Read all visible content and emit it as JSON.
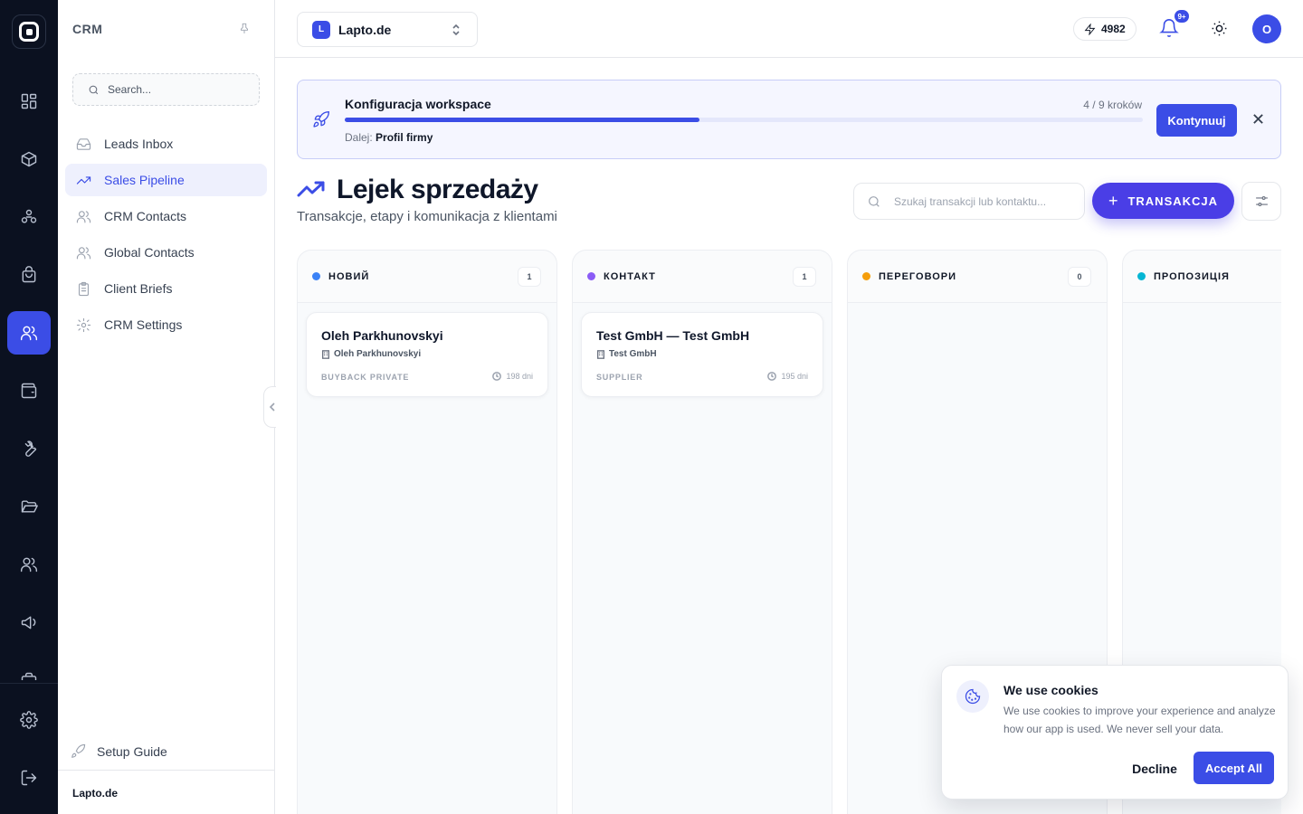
{
  "rail": {
    "items": [
      "logo-mark-icon",
      "dashboard-icon",
      "box-icon",
      "integrations-icon",
      "shopping-bag-icon",
      "users-icon",
      "wallet-icon",
      "wrench-icon",
      "folder-icon",
      "contacts-icon",
      "megaphone-icon",
      "briefcase-icon",
      "gear-icon",
      "logout-icon"
    ],
    "active_item": "users-icon"
  },
  "sidebar": {
    "title": "CRM",
    "search_placeholder": "Search...",
    "items": [
      {
        "label": "Leads Inbox",
        "icon": "inbox-icon"
      },
      {
        "label": "Sales Pipeline",
        "icon": "trending-up-icon",
        "active": true
      },
      {
        "label": "CRM Contacts",
        "icon": "users-icon"
      },
      {
        "label": "Global Contacts",
        "icon": "users-icon"
      },
      {
        "label": "Client Briefs",
        "icon": "clipboard-icon"
      },
      {
        "label": "CRM Settings",
        "icon": "gear-icon"
      }
    ],
    "setup_label": "Setup Guide",
    "footer_workspace": "Lapto.de"
  },
  "topbar": {
    "workspace_initial": "L",
    "workspace_name": "Lapto.de",
    "credits": "4982",
    "notifications_badge": "9+",
    "avatar_initial": "O"
  },
  "banner": {
    "title": "Konfiguracja workspace",
    "steps": "4 / 9 kroków",
    "progress": 0.444,
    "next_label": "Dalej:",
    "next_value": "Profil firmy",
    "continue_label": "Kontynuuj"
  },
  "page": {
    "title": "Lejek sprzedaży",
    "subtitle": "Transakcje, etapy i komunikacja z klientami",
    "search_placeholder": "Szukaj transakcji lub kontaktu...",
    "add_label": "TRANSAKCJA"
  },
  "columns": [
    {
      "name": "НОВИЙ",
      "count": "1",
      "color": "#3b82f6",
      "card": {
        "title": "Oleh Parkhunovskyi",
        "company": "Oleh Parkhunovskyi",
        "tag": "BUYBACK PRIVATE",
        "age": "198 dni"
      }
    },
    {
      "name": "КОНТАКТ",
      "count": "1",
      "color": "#8b5cf6",
      "card": {
        "title": "Test GmbH — Test GmbH",
        "company": "Test GmbH",
        "tag": "SUPPLIER",
        "age": "195 dni"
      }
    },
    {
      "name": "ПЕРЕГОВОРИ",
      "count": "0",
      "color": "#f59e0b"
    },
    {
      "name": "ПРОПОЗИЦІЯ",
      "color": "#06b6d4"
    }
  ],
  "cookie": {
    "title": "We use cookies",
    "text": "We use cookies to improve your experience and analyze how our app is used. We never sell your data.",
    "decline_label": "Decline",
    "accept_label": "Accept All"
  }
}
